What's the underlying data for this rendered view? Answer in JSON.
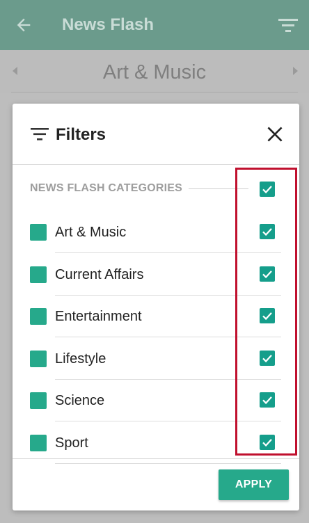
{
  "appbar": {
    "title": "News Flash",
    "back_icon": "arrow-left-icon",
    "filter_icon": "filter-icon"
  },
  "category_nav": {
    "current": "Art & Music"
  },
  "modal": {
    "title": "Filters",
    "section_header": "NEWS FLASH CATEGORIES",
    "select_all_checked": true,
    "categories": [
      {
        "label": "Art & Music",
        "checked": true
      },
      {
        "label": "Current Affairs",
        "checked": true
      },
      {
        "label": "Entertainment",
        "checked": true
      },
      {
        "label": "Lifestyle",
        "checked": true
      },
      {
        "label": "Science",
        "checked": true
      },
      {
        "label": "Sport",
        "checked": true
      }
    ],
    "apply_label": "APPLY"
  },
  "colors": {
    "accent": "#26a98b",
    "checkbox": "#159e8b",
    "appbar": "#6b9b8c",
    "highlight": "#c0102e"
  }
}
